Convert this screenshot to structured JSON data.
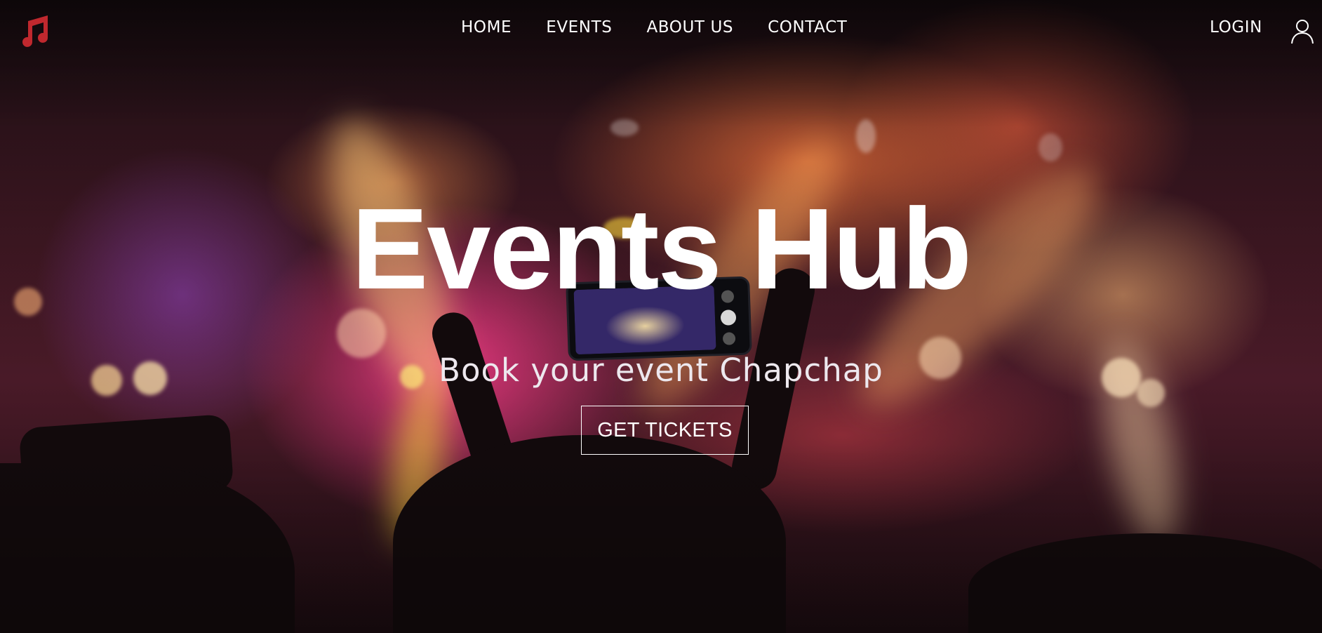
{
  "brand": {
    "logo_icon": "music-note-icon",
    "accent": "#c0282e"
  },
  "nav": {
    "items": [
      {
        "label": "HOME"
      },
      {
        "label": "EVENTS"
      },
      {
        "label": "ABOUT US"
      },
      {
        "label": "CONTACT"
      }
    ],
    "login_label": "LOGIN",
    "user_icon": "user-icon"
  },
  "hero": {
    "title": "Events Hub",
    "subtitle": "Book your event Chapchap",
    "cta_label": "GET TICKETS",
    "background": "concert-crowd-photo"
  }
}
